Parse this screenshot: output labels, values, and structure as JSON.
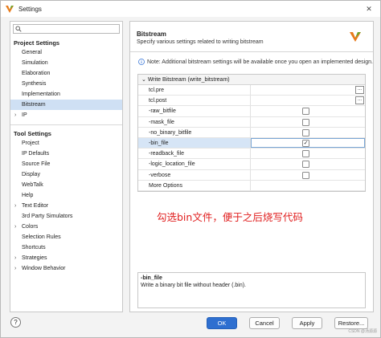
{
  "window": {
    "title": "Settings"
  },
  "sidebar": {
    "search_placeholder": "",
    "project_section": "Project Settings",
    "project_items": [
      {
        "label": "General"
      },
      {
        "label": "Simulation"
      },
      {
        "label": "Elaboration"
      },
      {
        "label": "Synthesis"
      },
      {
        "label": "Implementation"
      },
      {
        "label": "Bitstream",
        "selected": true
      },
      {
        "label": "IP",
        "expandable": true
      }
    ],
    "tool_section": "Tool Settings",
    "tool_items": [
      {
        "label": "Project"
      },
      {
        "label": "IP Defaults"
      },
      {
        "label": "Source File"
      },
      {
        "label": "Display"
      },
      {
        "label": "WebTalk"
      },
      {
        "label": "Help"
      },
      {
        "label": "Text Editor",
        "expandable": true
      },
      {
        "label": "3rd Party Simulators"
      },
      {
        "label": "Colors",
        "expandable": true
      },
      {
        "label": "Selection Rules"
      },
      {
        "label": "Shortcuts"
      },
      {
        "label": "Strategies",
        "expandable": true
      },
      {
        "label": "Window Behavior",
        "expandable": true
      }
    ]
  },
  "main": {
    "title": "Bitstream",
    "subtitle": "Specify various settings related to writing bitstream",
    "note": "Note: Additional bitstream settings will be available once you open an implemented design.",
    "group_label": "Write Bitstream (write_bitstream)",
    "rows": [
      {
        "name": "tcl.pre",
        "type": "browse"
      },
      {
        "name": "tcl.post",
        "type": "browse"
      },
      {
        "name": "-raw_bitfile",
        "type": "checkbox",
        "checked": false
      },
      {
        "name": "-mask_file",
        "type": "checkbox",
        "checked": false
      },
      {
        "name": "-no_binary_bitfile",
        "type": "checkbox",
        "checked": false
      },
      {
        "name": "-bin_file",
        "type": "checkbox",
        "checked": true,
        "selected": true
      },
      {
        "name": "-readback_file",
        "type": "checkbox",
        "checked": false
      },
      {
        "name": "-logic_location_file",
        "type": "checkbox",
        "checked": false
      },
      {
        "name": "-verbose",
        "type": "checkbox",
        "checked": false
      },
      {
        "name": "More Options",
        "type": "text"
      }
    ],
    "browse_label": "...",
    "check_mark": "✓",
    "annotation": "勾选bin文件，便于之后烧写代码",
    "description": {
      "title": "-bin_file",
      "text": "Write a binary bit file without header (.bin)."
    }
  },
  "footer": {
    "help": "?",
    "ok": "OK",
    "cancel": "Cancel",
    "apply": "Apply",
    "restore": "Restore...",
    "watermark": "CSDN @汤源源"
  },
  "colors": {
    "accent": "#2e6fd0",
    "selection": "#cfe0f4",
    "annotation": "#e01e1e"
  }
}
